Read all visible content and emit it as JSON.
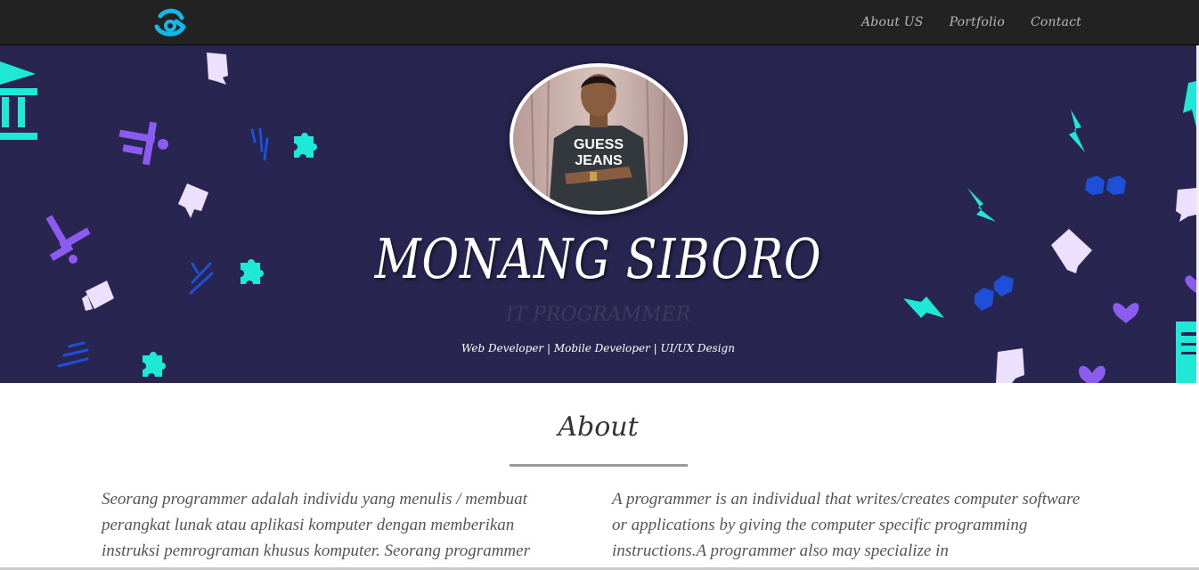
{
  "navbar": {
    "logo_icon": "brand-logo-icon",
    "links": [
      {
        "label": "About US"
      },
      {
        "label": "Portfolio"
      },
      {
        "label": "Contact"
      }
    ]
  },
  "hero": {
    "name": "MONANG SIBORO",
    "role": "IT PROGRAMMER",
    "skills": "Web Developer | Mobile Developer | UI/UX Design",
    "photo_shirt_text_1": "GUESS",
    "photo_shirt_text_2": "JEANS",
    "colors": {
      "background": "#282650",
      "teal": "#1de9d6",
      "purple": "#8c5cf0",
      "blue": "#1e4fd8",
      "lavender": "#ede0ff"
    }
  },
  "about": {
    "title": "About",
    "paragraph_id": "Seorang programmer adalah individu yang menulis / membuat perangkat lunak atau aplikasi komputer dengan memberikan instruksi pemrograman khusus komputer. Seorang programmer",
    "paragraph_en": "A programmer is an individual that writes/creates computer software or applications by giving the computer specific programming instructions.A programmer also may specialize in"
  }
}
